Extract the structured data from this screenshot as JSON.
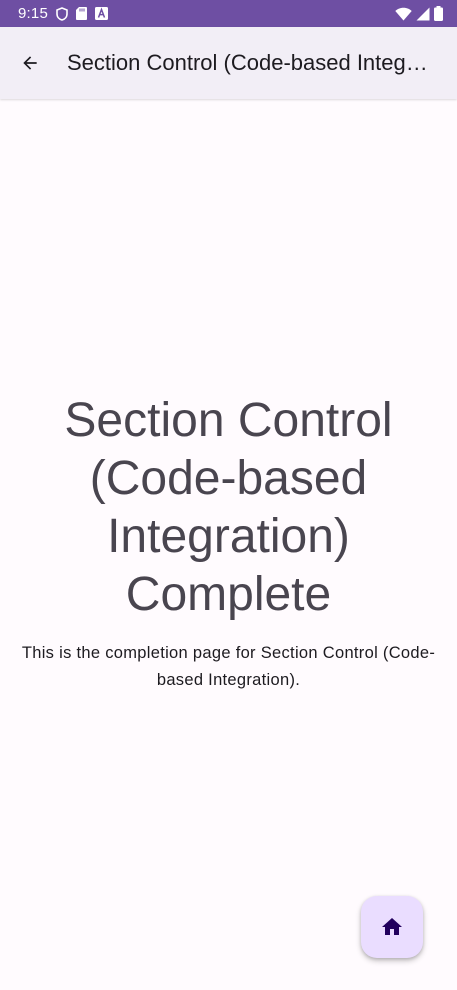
{
  "status_bar": {
    "time": "9:15",
    "left_icons": [
      "shield-icon",
      "sd-card-icon",
      "keyboard-a-icon"
    ],
    "right_icons": [
      "wifi-icon",
      "signal-icon",
      "battery-icon"
    ],
    "background": "#6e4fa3"
  },
  "app_bar": {
    "title": "Section Control (Code-based Integration)",
    "back_icon": "arrow-back-icon",
    "background": "#f2eef6"
  },
  "main": {
    "headline": "Section Control (Code-based Integration) Complete",
    "description": "This is the completion page for Section Control (Code-based Integration)."
  },
  "fab": {
    "icon": "home-icon",
    "background": "#eaddff",
    "icon_color": "#21005d"
  }
}
